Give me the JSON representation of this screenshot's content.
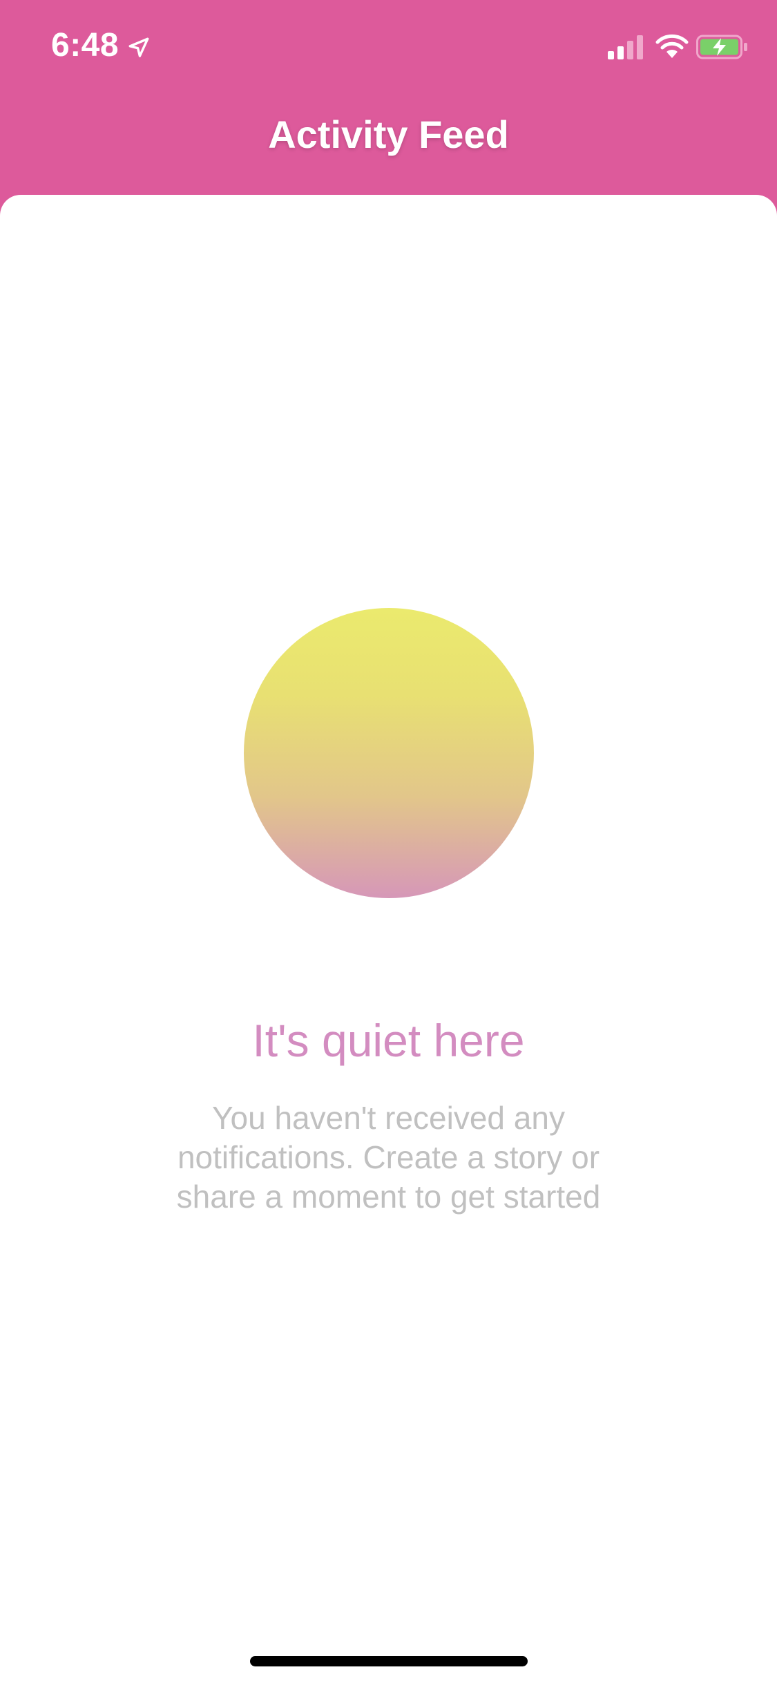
{
  "status_bar": {
    "time": "6:48"
  },
  "nav": {
    "title": "Activity Feed"
  },
  "empty_state": {
    "title": "It's quiet here",
    "message": "You haven't received any notifications. Create a story or share a moment to get started"
  },
  "colors": {
    "header_background": "#dd5a9b",
    "title_accent": "#d38cc0",
    "message_text": "#c0c0c0",
    "circle_gradient_top": "#ebea6e",
    "circle_gradient_bottom": "#d697b8"
  },
  "icons": {
    "location": "location-arrow-icon",
    "signal": "cellular-signal-icon",
    "wifi": "wifi-icon",
    "battery": "battery-charging-icon"
  }
}
